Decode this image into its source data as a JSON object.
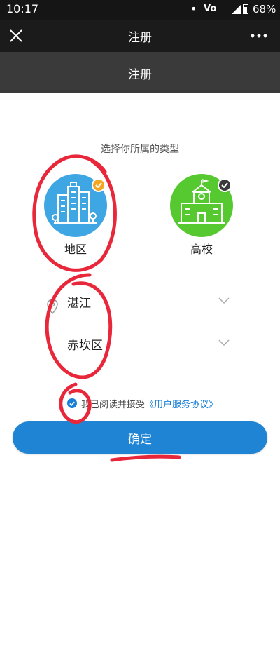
{
  "status_bar": {
    "time": "10:17",
    "dot": "•",
    "network": "Vo",
    "battery": "68%"
  },
  "navbar": {
    "title": "注册"
  },
  "subheader": {
    "title": "注册"
  },
  "prompt": "选择你所属的类型",
  "types": [
    {
      "label": "地区",
      "color": "#3fa6e4",
      "selected": true
    },
    {
      "label": "高校",
      "color": "#55c92f",
      "selected": false
    }
  ],
  "fields": {
    "city": "湛江",
    "district": "赤坎区"
  },
  "agreement": {
    "text": "我已阅读并接受",
    "link": "《用户服务协议》",
    "checked": true
  },
  "confirm_label": "确定",
  "colors": {
    "accent": "#1f84d4",
    "annotation": "#e8283a"
  }
}
